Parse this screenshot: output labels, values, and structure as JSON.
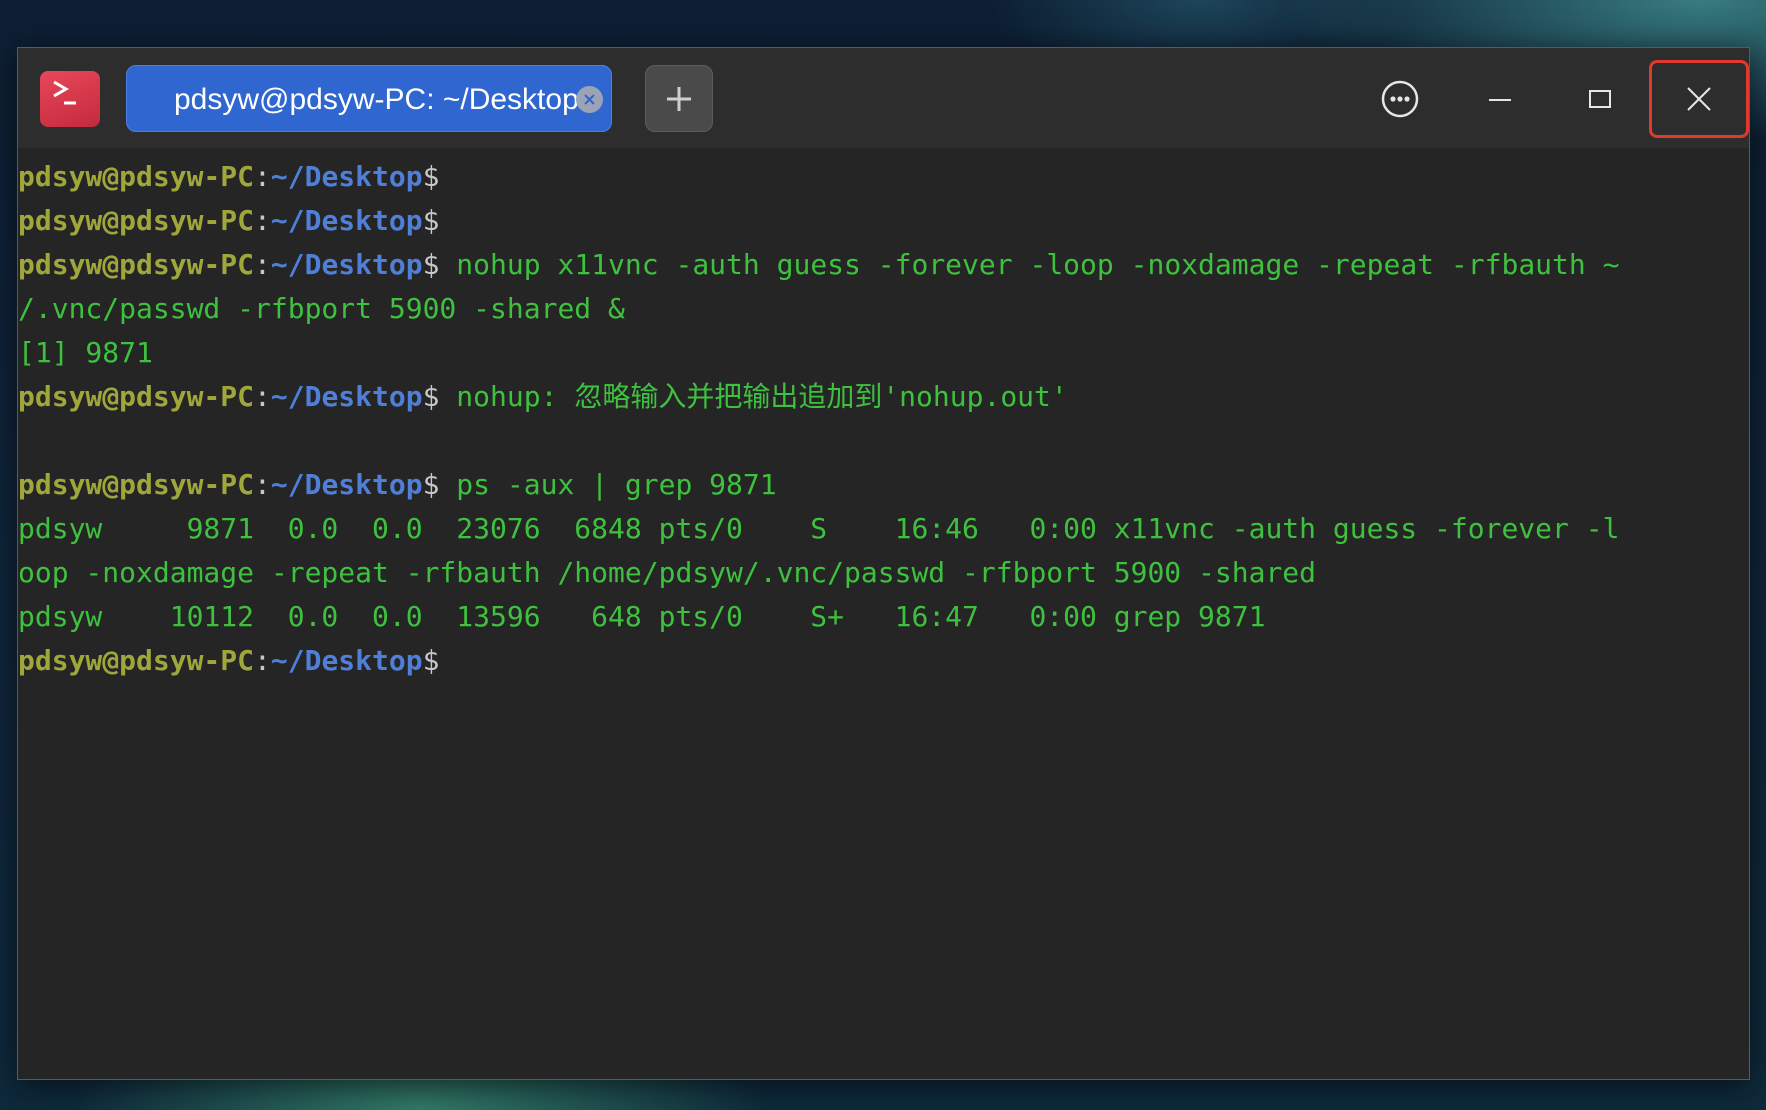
{
  "window": {
    "tab_title": "pdsyw@pdsyw-PC: ~/Desktop"
  },
  "icons": {
    "app": "terminal-icon",
    "tab_close": "close-icon",
    "new_tab": "plus-icon",
    "menu": "more-icon",
    "minimize": "minimize-icon",
    "maximize": "maximize-icon",
    "close": "close-icon"
  },
  "colors": {
    "tab_active": "#2f66d0",
    "prompt_user": "#a0a73a",
    "prompt_path": "#4f7fd8",
    "output_text": "#3ec13e",
    "close_highlight": "#e03a2e"
  },
  "terminal": {
    "prompt": {
      "user_host": "pdsyw@pdsyw-PC",
      "colon": ":",
      "path": "~/Desktop",
      "symbol": "$"
    },
    "lines": [
      {
        "prompt": true,
        "text": ""
      },
      {
        "prompt": true,
        "text": ""
      },
      {
        "prompt": true,
        "text": " nohup x11vnc -auth guess -forever -loop -noxdamage -repeat -rfbauth ~"
      },
      {
        "prompt": false,
        "text": "/.vnc/passwd -rfbport 5900 -shared &"
      },
      {
        "prompt": false,
        "text": "[1] 9871"
      },
      {
        "prompt": true,
        "text": " nohup: 忽略输入并把输出追加到'nohup.out'"
      },
      {
        "prompt": false,
        "text": ""
      },
      {
        "prompt": true,
        "text": " ps -aux | grep 9871"
      },
      {
        "prompt": false,
        "text": "pdsyw     9871  0.0  0.0  23076  6848 pts/0    S    16:46   0:00 x11vnc -auth guess -forever -l"
      },
      {
        "prompt": false,
        "text": "oop -noxdamage -repeat -rfbauth /home/pdsyw/.vnc/passwd -rfbport 5900 -shared"
      },
      {
        "prompt": false,
        "text": "pdsyw    10112  0.0  0.0  13596   648 pts/0    S+   16:47   0:00 grep 9871"
      },
      {
        "prompt": true,
        "text": ""
      }
    ]
  }
}
